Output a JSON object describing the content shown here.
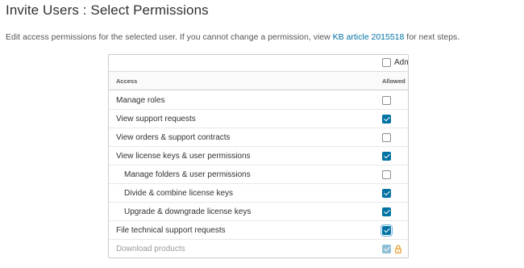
{
  "page": {
    "title": "Invite Users : Select Permissions",
    "desc_pre": "Edit access permissions for the selected user. If you cannot change a permission, view ",
    "kb_link": "KB article 2015518",
    "desc_post": " for next steps."
  },
  "table": {
    "admin_label": "Administrator",
    "admin_checked": false,
    "header_access": "Access",
    "header_allowed": "Allowed",
    "rows": [
      {
        "label": "Manage roles",
        "checked": false,
        "level": "top"
      },
      {
        "label": "View support requests",
        "checked": true,
        "level": "top"
      },
      {
        "label": "View orders & support contracts",
        "checked": false,
        "level": "top"
      },
      {
        "label": "View license keys & user permissions",
        "checked": true,
        "level": "top"
      },
      {
        "label": "Manage folders & user permissions",
        "checked": false,
        "level": "sub"
      },
      {
        "label": "Divide & combine license keys",
        "checked": true,
        "level": "sub"
      },
      {
        "label": "Upgrade & downgrade license keys",
        "checked": true,
        "level": "sub"
      },
      {
        "label": "File technical support requests",
        "checked": true,
        "level": "top",
        "focused": true
      },
      {
        "label": "Download products",
        "checked": true,
        "level": "top",
        "disabled": true,
        "locked": true
      }
    ]
  },
  "icons": {
    "info": "info-circle-icon",
    "lock": "lock-icon"
  },
  "colors": {
    "accent": "#0072a3",
    "lock": "#e08a00"
  }
}
